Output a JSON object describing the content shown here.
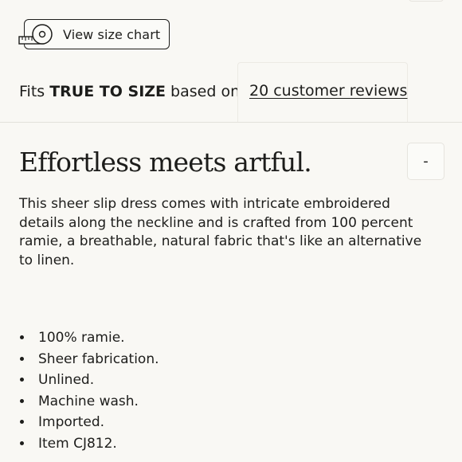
{
  "size_chart": {
    "label": "View size chart",
    "icon": "measuring-tape-icon"
  },
  "fit": {
    "prefix": "Fits",
    "emphasis": "TRUE TO SIZE",
    "suffix": "based on",
    "reviews_link": "20 customer reviews"
  },
  "details": {
    "headline": "Effortless meets artful.",
    "toggle_label": "-",
    "description": "This sheer slip dress comes with intricate embroidered details along the neckline and is crafted from 100 percent ramie, a breathable, natural fabric that's like an alternative to linen.",
    "features": [
      "100% ramie.",
      "Sheer fabrication.",
      "Unlined.",
      "Machine wash.",
      "Imported.",
      "Item CJ812."
    ]
  }
}
